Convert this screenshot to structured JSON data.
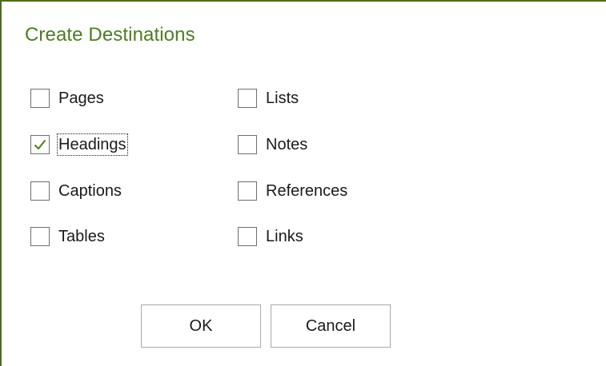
{
  "dialog": {
    "title": "Create Destinations"
  },
  "options": {
    "pages": {
      "label": "Pages",
      "checked": false
    },
    "headings": {
      "label": "Headings",
      "checked": true
    },
    "captions": {
      "label": "Captions",
      "checked": false
    },
    "tables": {
      "label": "Tables",
      "checked": false
    },
    "lists": {
      "label": "Lists",
      "checked": false
    },
    "notes": {
      "label": "Notes",
      "checked": false
    },
    "references": {
      "label": "References",
      "checked": false
    },
    "links": {
      "label": "Links",
      "checked": false
    }
  },
  "buttons": {
    "ok_label": "OK",
    "cancel_label": "Cancel"
  },
  "colors": {
    "title": "#4e7d1f",
    "checkmark": "#4e7d1f",
    "border_accent": "#4f6b1e"
  },
  "icons": {
    "check": "checkmark-icon"
  }
}
